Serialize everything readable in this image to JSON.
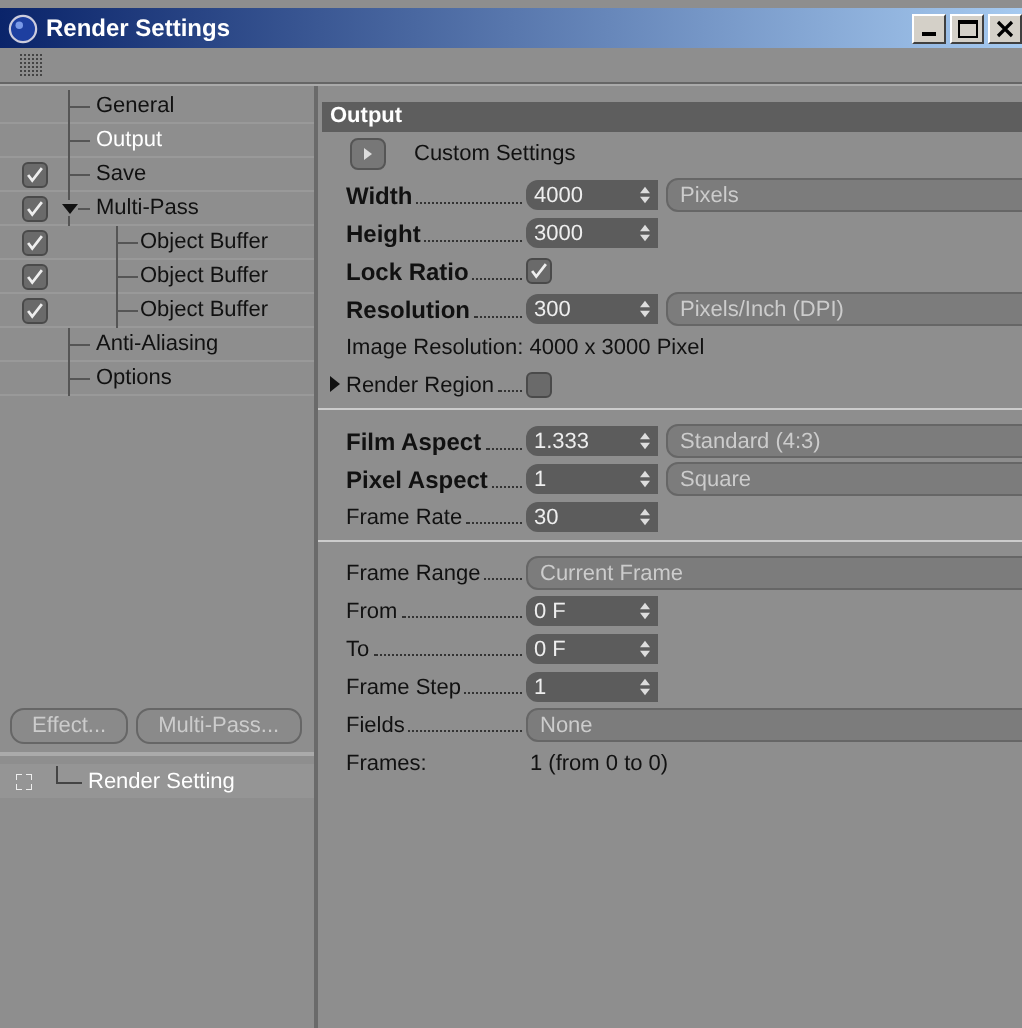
{
  "window": {
    "title": "Render Settings"
  },
  "tree": [
    {
      "label": "General",
      "selected": false
    },
    {
      "label": "Output",
      "selected": true
    },
    {
      "label": "Save",
      "selected": false,
      "checked": true
    },
    {
      "label": "Multi-Pass",
      "selected": false,
      "checked": true,
      "expanded": true,
      "children": [
        {
          "label": "Object Buffer",
          "selected": false,
          "checked": true
        },
        {
          "label": "Object Buffer",
          "selected": false,
          "checked": true
        },
        {
          "label": "Object Buffer",
          "selected": false,
          "checked": true
        }
      ]
    },
    {
      "label": "Anti-Aliasing",
      "selected": false
    },
    {
      "label": "Options",
      "selected": false
    }
  ],
  "buttons": [
    "Effect...",
    "Multi-Pass..."
  ],
  "settings_list": [
    {
      "label": "Render Setting",
      "selected": false
    }
  ],
  "panel": {
    "title": "Output",
    "preset": "Custom Settings",
    "groups": [
      [
        {
          "kind": "spinner",
          "label": "Width",
          "bold": true,
          "value": "4000",
          "dropdown": "Pixels"
        },
        {
          "kind": "spinner",
          "label": "Height",
          "bold": true,
          "value": "3000"
        },
        {
          "kind": "checkbox",
          "label": "Lock Ratio",
          "bold": true,
          "checked": true
        },
        {
          "kind": "spinner",
          "label": "Resolution",
          "bold": true,
          "value": "300",
          "dropdown": "Pixels/Inch (DPI)"
        },
        {
          "kind": "info",
          "label": "Image Resolution:",
          "value": "4000 x 3000 Pixel"
        },
        {
          "kind": "checkbox",
          "label": "Render Region",
          "bold": false,
          "checked": false,
          "collapsed": true
        }
      ],
      [
        {
          "kind": "spinner",
          "label": "Film Aspect",
          "bold": true,
          "value": "1.333",
          "dropdown": "Standard (4:3)"
        },
        {
          "kind": "spinner",
          "label": "Pixel Aspect",
          "bold": true,
          "value": "1",
          "dropdown": "Square"
        },
        {
          "kind": "spinner",
          "label": "Frame Rate",
          "bold": false,
          "value": "30"
        }
      ],
      [
        {
          "kind": "dropdown",
          "label": "Frame Range",
          "bold": false,
          "dropdown": "Current Frame"
        },
        {
          "kind": "spinner",
          "label": "From",
          "bold": false,
          "value": "0 F"
        },
        {
          "kind": "spinner",
          "label": "To",
          "bold": false,
          "value": "0 F"
        },
        {
          "kind": "spinner",
          "label": "Frame Step",
          "bold": false,
          "value": "1"
        },
        {
          "kind": "dropdown",
          "label": "Fields",
          "bold": false,
          "dropdown": "None"
        },
        {
          "kind": "result",
          "label": "Frames:",
          "value": "1 (from 0 to 0)"
        }
      ]
    ]
  }
}
